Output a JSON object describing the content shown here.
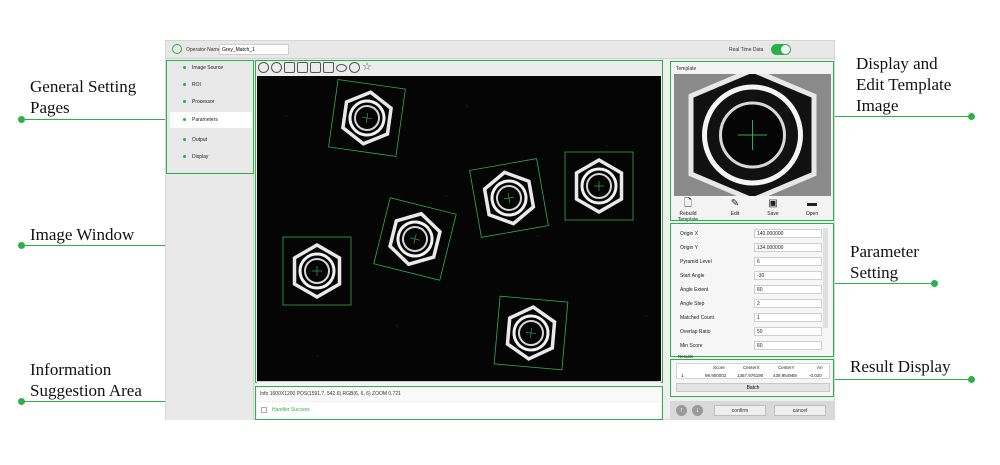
{
  "annotations": {
    "general_setting_pages": [
      "General Setting",
      "Pages"
    ],
    "image_window": "Image Window",
    "information_area": [
      "Information",
      "Suggestion Area"
    ],
    "display_edit_template": [
      "Display and",
      "Edit Template",
      "Image"
    ],
    "parameter_setting": [
      "Parameter",
      "Setting"
    ],
    "result_display": "Result Display"
  },
  "header": {
    "operator_label": "Operator Name",
    "operator_value": "Grey_Match_1",
    "realtime_label": "Real Time Data"
  },
  "sidebar": {
    "items": [
      {
        "label": "Image Source"
      },
      {
        "label": "ROI"
      },
      {
        "label": "Processor"
      },
      {
        "label": "Parameters"
      },
      {
        "label": "Output"
      },
      {
        "label": "Display"
      }
    ],
    "active_index": 3
  },
  "toolbar": {
    "icons": [
      "zoom-in-icon",
      "zoom-out-icon",
      "fit-icon",
      "one-to-one-icon",
      "rectangle-icon",
      "polygon-icon",
      "ellipse-icon",
      "circle-icon",
      "star-icon"
    ]
  },
  "info": {
    "status_text": "Info 1600X1200 POS(1591.7, 542.6) RGB(6, 6, 6) ZOOM 0.721",
    "message": "Handler Success"
  },
  "template": {
    "title": "Template",
    "buttons": [
      {
        "label": "Rebuild Template"
      },
      {
        "label": "Edit"
      },
      {
        "label": "Save"
      },
      {
        "label": "Open"
      }
    ]
  },
  "parameters": [
    {
      "label": "Origin X",
      "value": "140.000000"
    },
    {
      "label": "Origin Y",
      "value": "134.000000"
    },
    {
      "label": "Pyramid Level",
      "value": "6"
    },
    {
      "label": "Start Angle",
      "value": "-30"
    },
    {
      "label": "Angle Extent",
      "value": "60"
    },
    {
      "label": "Angle Step",
      "value": "2"
    },
    {
      "label": "Matched Count",
      "value": "1"
    },
    {
      "label": "Overlap Ratio",
      "value": "50"
    },
    {
      "label": "Min Score",
      "value": "60"
    }
  ],
  "results": {
    "title": "Results",
    "columns": [
      "",
      "Score",
      "CenterX",
      "CenterY",
      "An"
    ],
    "rows": [
      [
        "1",
        "99.900002",
        "1367.976190",
        "439.954959",
        "-0.020"
      ]
    ],
    "batch_label": "Batch"
  },
  "footer": {
    "confirm_label": "confirm",
    "cancel_label": "cancel"
  },
  "colors": {
    "accent": "#2bb04a",
    "image_bg": "#050505"
  }
}
